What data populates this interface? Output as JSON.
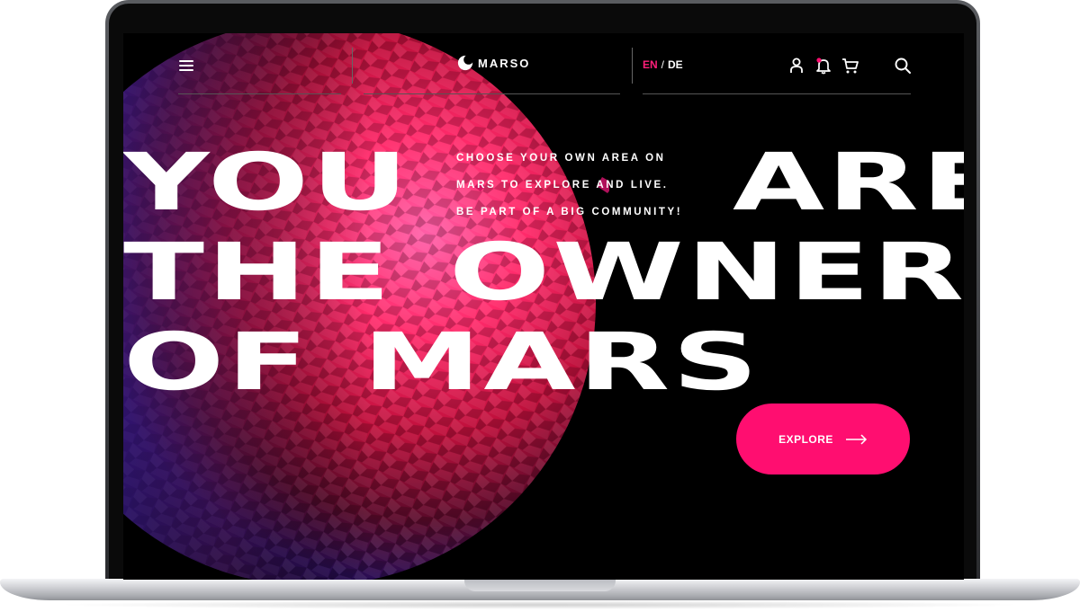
{
  "header": {
    "brand": "MARSO",
    "lang_active": "EN",
    "lang_separator": "/",
    "lang_other": "DE",
    "icons": [
      "menu-icon",
      "user-icon",
      "bell-icon",
      "cart-icon",
      "search-icon"
    ]
  },
  "hero": {
    "tagline_lines": [
      "CHOOSE YOUR OWN AREA ON",
      "MARS TO EXPLORE AND LIVE.",
      "BE PART OF A BIG COMMUNITY!"
    ],
    "words": {
      "you": "YOU",
      "are": "ARE",
      "the": "THE",
      "owner": "OWNER_",
      "of": "OF",
      "mars": "MARS"
    },
    "cta_label": "EXPLORE"
  },
  "colors": {
    "accent": "#ff0e70",
    "background": "#000000",
    "text": "#ffffff"
  }
}
